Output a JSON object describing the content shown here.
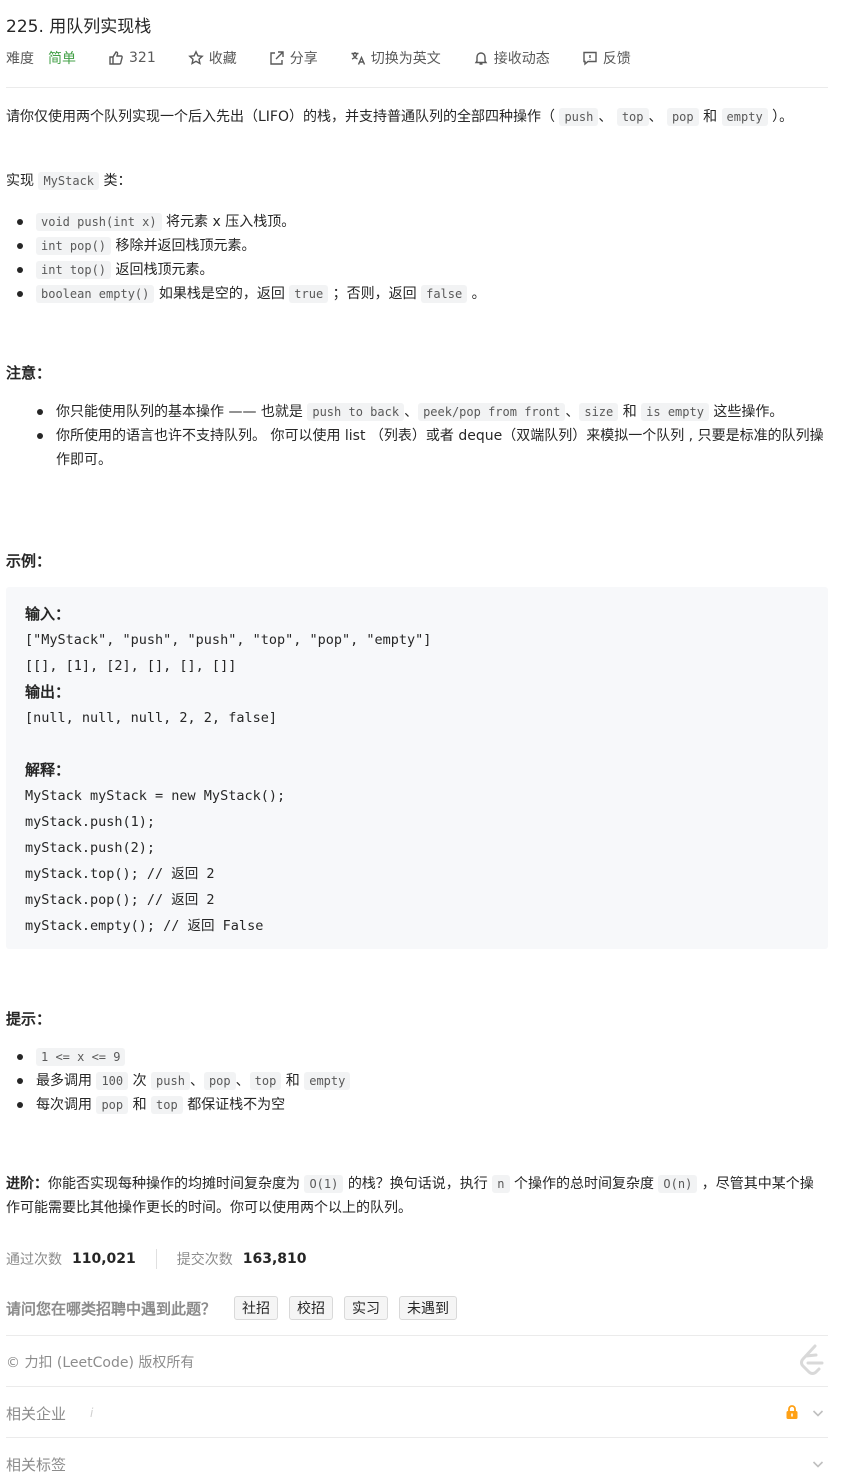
{
  "problem": {
    "title": "225. 用队列实现栈",
    "difficulty_label": "难度",
    "difficulty": "简单",
    "likes": "321",
    "actions": {
      "favorite": "收藏",
      "share": "分享",
      "switch_lang": "切换为英文",
      "subscribe": "接收动态",
      "feedback": "反馈"
    }
  },
  "description": {
    "intro_prefix": "请你仅使用两个队列实现一个后入先出（LIFO）的栈，并支持普通队列的全部四种操作（",
    "ops": [
      "push",
      "top",
      "pop",
      "empty"
    ],
    "sep": "、",
    "and": "和",
    "intro_suffix": "）。",
    "impl_prefix": "实现",
    "impl_class": "MyStack",
    "impl_suffix": "类：",
    "methods": [
      {
        "code": "void push(int x)",
        "text": "将元素 x 压入栈顶。"
      },
      {
        "code": "int pop()",
        "text": "移除并返回栈顶元素。"
      },
      {
        "code": "int top()",
        "text": "返回栈顶元素。"
      },
      {
        "code": "boolean empty()",
        "text": "如果栈是空的，返回",
        "code2": "true",
        "text2": "；否则，返回",
        "code3": "false",
        "text3": "。"
      }
    ]
  },
  "notes": {
    "heading": "注意：",
    "n1_prefix": "你只能使用队列的基本操作 —— 也就是",
    "n1_codes": [
      "push to back",
      "peek/pop from front",
      "size",
      "is empty"
    ],
    "n1_suffix": "这些操作。",
    "n2": "你所使用的语言也许不支持队列。 你可以使用 list （列表）或者 deque（双端队列）来模拟一个队列 , 只要是标准的队列操作即可。"
  },
  "example": {
    "heading": "示例：",
    "input_label": "输入：",
    "input_line1": "[\"MyStack\", \"push\", \"push\", \"top\", \"pop\", \"empty\"]",
    "input_line2": "[[], [1], [2], [], [], []]",
    "output_label": "输出：",
    "output_line": "[null, null, null, 2, 2, false]",
    "explain_label": "解释：",
    "explain_lines": [
      "MyStack myStack = new MyStack();",
      "myStack.push(1);",
      "myStack.push(2);",
      "myStack.top(); // 返回 2",
      "myStack.pop(); // 返回 2",
      "myStack.empty(); // 返回 False"
    ]
  },
  "hints": {
    "heading": "提示：",
    "h1_code": "1 <= x <= 9",
    "h2_prefix": "最多调用",
    "h2_count": "100",
    "h2_mid": "次",
    "h2_codes": [
      "push",
      "pop",
      "top",
      "empty"
    ],
    "h3_prefix": "每次调用",
    "h3_code1": "pop",
    "h3_and": "和",
    "h3_code2": "top",
    "h3_suffix": "都保证栈不为空"
  },
  "advanced": {
    "label": "进阶：",
    "text1": "你能否实现每种操作的均摊时间复杂度为",
    "code1": "O(1)",
    "text2": "的栈？换句话说，执行",
    "code2": "n",
    "text3": "个操作的总时间复杂度",
    "code3": "O(n)",
    "text4": "，尽管其中某个操作可能需要比其他操作更长的时间。你可以使用两个以上的队列。"
  },
  "stats": {
    "accepted_label": "通过次数",
    "accepted": "110,021",
    "submitted_label": "提交次数",
    "submitted": "163,810"
  },
  "interview": {
    "question": "请问您在哪类招聘中遇到此题？",
    "options": [
      "社招",
      "校招",
      "实习",
      "未遇到"
    ]
  },
  "footer": {
    "copyright": "© 力扣 (LeetCode) 版权所有",
    "related_companies": "相关企业",
    "info_mark": "i",
    "related_tags": "相关标签"
  },
  "colors": {
    "easy": "#43a047",
    "lock": "#ffa116"
  }
}
